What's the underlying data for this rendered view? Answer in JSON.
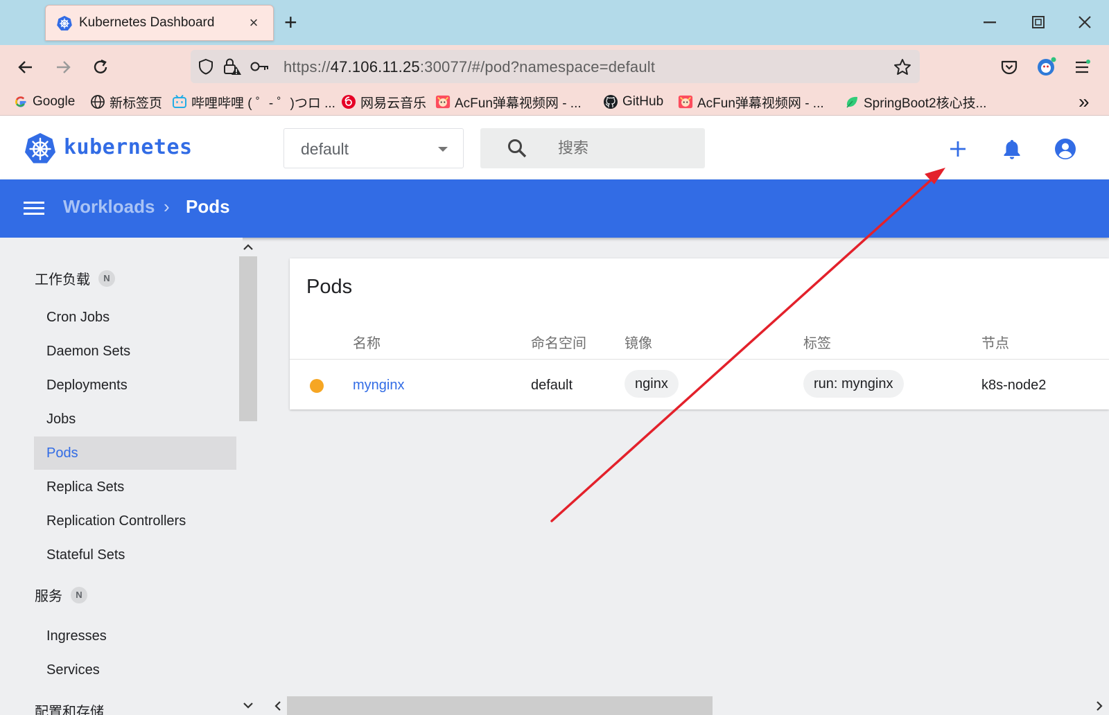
{
  "browser": {
    "tab_title": "Kubernetes Dashboard",
    "tab_close": "×",
    "new_tab": "+",
    "url": {
      "scheme": "https://",
      "host": "47.106.11.25",
      "rest": ":30077/#/pod?namespace=default"
    },
    "bookmarks": [
      {
        "label": "Google",
        "icon": "google-icon"
      },
      {
        "label": "新标签页",
        "icon": "globe-icon"
      },
      {
        "label": "哔哩哔哩 ( ゜- ゜)つロ ...",
        "icon": "bilibili-icon"
      },
      {
        "label": "网易云音乐",
        "icon": "netease-music-icon"
      },
      {
        "label": "AcFun弹幕视频网 - ...",
        "icon": "acfun-icon"
      },
      {
        "label": "GitHub",
        "icon": "github-icon"
      },
      {
        "label": "AcFun弹幕视频网 - ...",
        "icon": "acfun-icon"
      },
      {
        "label": "SpringBoot2核心技...",
        "icon": "yuque-icon"
      }
    ],
    "overflow": "»"
  },
  "header": {
    "brand": "kubernetes",
    "namespace": "default",
    "search_placeholder": "搜索"
  },
  "toolbar": {
    "breadcrumb_parent": "Workloads",
    "breadcrumb_sep": "›",
    "breadcrumb_current": "Pods"
  },
  "sidebar": {
    "sections": [
      {
        "title": "工作负载",
        "badge": "N"
      },
      {
        "title": "服务",
        "badge": "N"
      },
      {
        "title": "配置和存储"
      }
    ],
    "items": [
      {
        "label": "Cron Jobs"
      },
      {
        "label": "Daemon Sets"
      },
      {
        "label": "Deployments"
      },
      {
        "label": "Jobs"
      },
      {
        "label": "Pods",
        "active": true
      },
      {
        "label": "Replica Sets"
      },
      {
        "label": "Replication Controllers"
      },
      {
        "label": "Stateful Sets"
      },
      {
        "label": "Ingresses"
      },
      {
        "label": "Services"
      }
    ]
  },
  "pods": {
    "title": "Pods",
    "columns": [
      "名称",
      "命名空间",
      "镜像",
      "标签",
      "节点"
    ],
    "rows": [
      {
        "status_color": "#f6a623",
        "name": "mynginx",
        "namespace": "default",
        "image": "nginx",
        "label": "run: mynginx",
        "node": "k8s-node2"
      }
    ]
  },
  "colors": {
    "primary": "#326ce5",
    "annotation_arrow": "#e3212b",
    "pending_status": "#f6a623"
  }
}
